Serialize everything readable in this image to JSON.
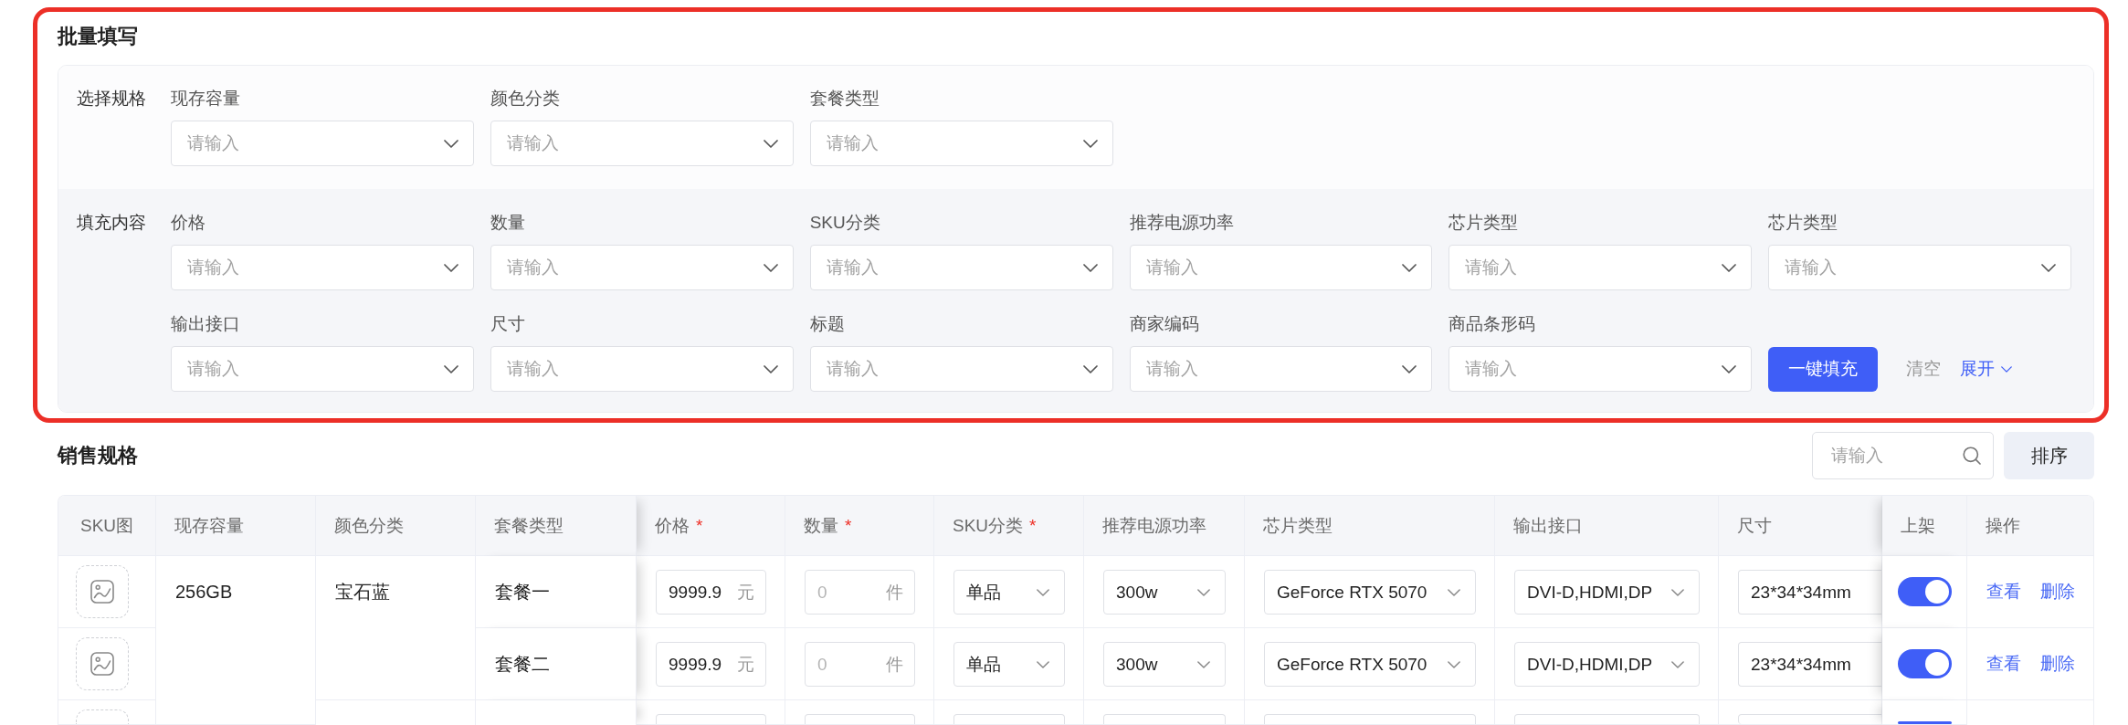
{
  "batch_fill": {
    "title": "批量填写",
    "highlighted": true,
    "spec_section": {
      "label": "选择规格",
      "fields": [
        {
          "label": "现存容量",
          "placeholder": "请输入"
        },
        {
          "label": "颜色分类",
          "placeholder": "请输入"
        },
        {
          "label": "套餐类型",
          "placeholder": "请输入"
        }
      ]
    },
    "fill_section": {
      "label": "填充内容",
      "fields": [
        {
          "label": "价格",
          "placeholder": "请输入"
        },
        {
          "label": "数量",
          "placeholder": "请输入"
        },
        {
          "label": "SKU分类",
          "placeholder": "请输入"
        },
        {
          "label": "推荐电源功率",
          "placeholder": "请输入"
        },
        {
          "label": "芯片类型",
          "placeholder": "请输入"
        },
        {
          "label": "芯片类型",
          "placeholder": "请输入"
        },
        {
          "label": "输出接口",
          "placeholder": "请输入"
        },
        {
          "label": "尺寸",
          "placeholder": "请输入"
        },
        {
          "label": "标题",
          "placeholder": "请输入"
        },
        {
          "label": "商家编码",
          "placeholder": "请输入"
        },
        {
          "label": "商品条形码",
          "placeholder": "请输入"
        }
      ]
    },
    "actions": {
      "fill_button": "一键填充",
      "clear_button": "清空",
      "expand_button": "展开",
      "expanded": false
    }
  },
  "sales_spec": {
    "title": "销售规格",
    "search": {
      "placeholder": "请输入"
    },
    "sort_button": "排序",
    "table": {
      "columns": [
        {
          "label": "SKU图",
          "kind": "image"
        },
        {
          "label": "现存容量",
          "kind": "text"
        },
        {
          "label": "颜色分类",
          "kind": "text"
        },
        {
          "label": "套餐类型",
          "kind": "text"
        },
        {
          "label": "价格",
          "mark": "*",
          "kind": "unit_input"
        },
        {
          "label": "数量",
          "mark": "*",
          "kind": "unit_input"
        },
        {
          "label": "SKU分类",
          "mark": "*",
          "kind": "select"
        },
        {
          "label": "推荐电源功率",
          "kind": "select"
        },
        {
          "label": "芯片类型",
          "kind": "select"
        },
        {
          "label": "输出接口",
          "kind": "select"
        },
        {
          "label": "尺寸",
          "kind": "input"
        },
        {
          "label": "上架",
          "kind": "switch"
        },
        {
          "label": "操作",
          "kind": "actions"
        }
      ],
      "capacities": [
        {
          "value": "256GB",
          "colors": [
            {
              "value": "宝石蓝",
              "skus": [
                {
                  "package": "套餐一",
                  "price": {
                    "value": "9999.9",
                    "unit": "元"
                  },
                  "quantity": {
                    "placeholder": "0",
                    "unit": "件"
                  },
                  "sku_type": {
                    "value": "单品"
                  },
                  "power": {
                    "value": "300w"
                  },
                  "chip": {
                    "value": "GeForce RTX 5070"
                  },
                  "ports": {
                    "value": "DVI-D,HDMI,DP"
                  },
                  "size": {
                    "value": "23*34*34mm"
                  },
                  "listed": true,
                  "actions": [
                    "查看",
                    "删除"
                  ]
                },
                {
                  "package": "套餐二",
                  "price": {
                    "value": "9999.9",
                    "unit": "元"
                  },
                  "quantity": {
                    "placeholder": "0",
                    "unit": "件"
                  },
                  "sku_type": {
                    "value": "单品"
                  },
                  "power": {
                    "value": "300w"
                  },
                  "chip": {
                    "value": "GeForce RTX 5070"
                  },
                  "ports": {
                    "value": "DVI-D,HDMI,DP"
                  },
                  "size": {
                    "value": "23*34*34mm"
                  },
                  "listed": true,
                  "actions": [
                    "查看",
                    "删除"
                  ]
                }
              ]
            },
            {
              "skus": [
                {
                  "listed": true
                }
              ]
            }
          ]
        }
      ]
    }
  }
}
